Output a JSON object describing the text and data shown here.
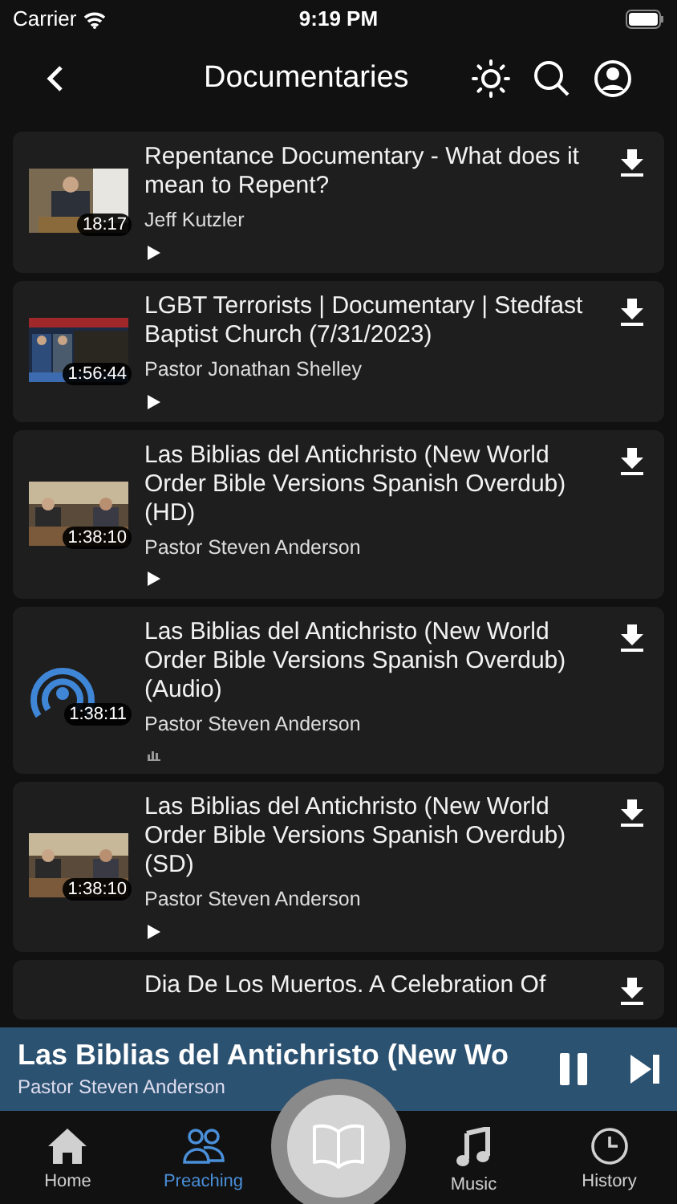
{
  "status_bar": {
    "carrier": "Carrier",
    "time": "9:19 PM"
  },
  "nav": {
    "title": "Documentaries"
  },
  "items": [
    {
      "kind": "video",
      "title": "Repentance Documentary - What does it mean to Repent?",
      "author": "Jeff Kutzler",
      "duration": "18:17"
    },
    {
      "kind": "video",
      "title": "LGBT Terrorists | Documentary | Stedfast Baptist Church (7/31/2023)",
      "author": "Pastor Jonathan Shelley",
      "duration": "1:56:44"
    },
    {
      "kind": "video",
      "title": "Las Biblias del Antichristo (New World Order Bible Versions Spanish Overdub) (HD)",
      "author": "Pastor Steven Anderson",
      "duration": "1:38:10"
    },
    {
      "kind": "audio",
      "title": "Las Biblias del Antichristo (New World Order Bible Versions Spanish Overdub) (Audio)",
      "author": "Pastor Steven Anderson",
      "duration": "1:38:11"
    },
    {
      "kind": "video",
      "title": "Las Biblias del Antichristo (New World Order Bible Versions Spanish Overdub) (SD)",
      "author": "Pastor Steven Anderson",
      "duration": "1:38:10"
    },
    {
      "kind": "partial",
      "title": "Dia De Los Muertos. A Celebration Of"
    }
  ],
  "player": {
    "title": "Las Biblias del Antichristo (New Wo",
    "author": "Pastor Steven Anderson"
  },
  "tabs": [
    {
      "label": "Home",
      "kind": "home",
      "selected": false
    },
    {
      "label": "Preaching",
      "kind": "people",
      "selected": true
    },
    {
      "kind": "book"
    },
    {
      "label": "Music",
      "kind": "music",
      "selected": false
    },
    {
      "label": "History",
      "kind": "clock",
      "selected": false
    }
  ]
}
